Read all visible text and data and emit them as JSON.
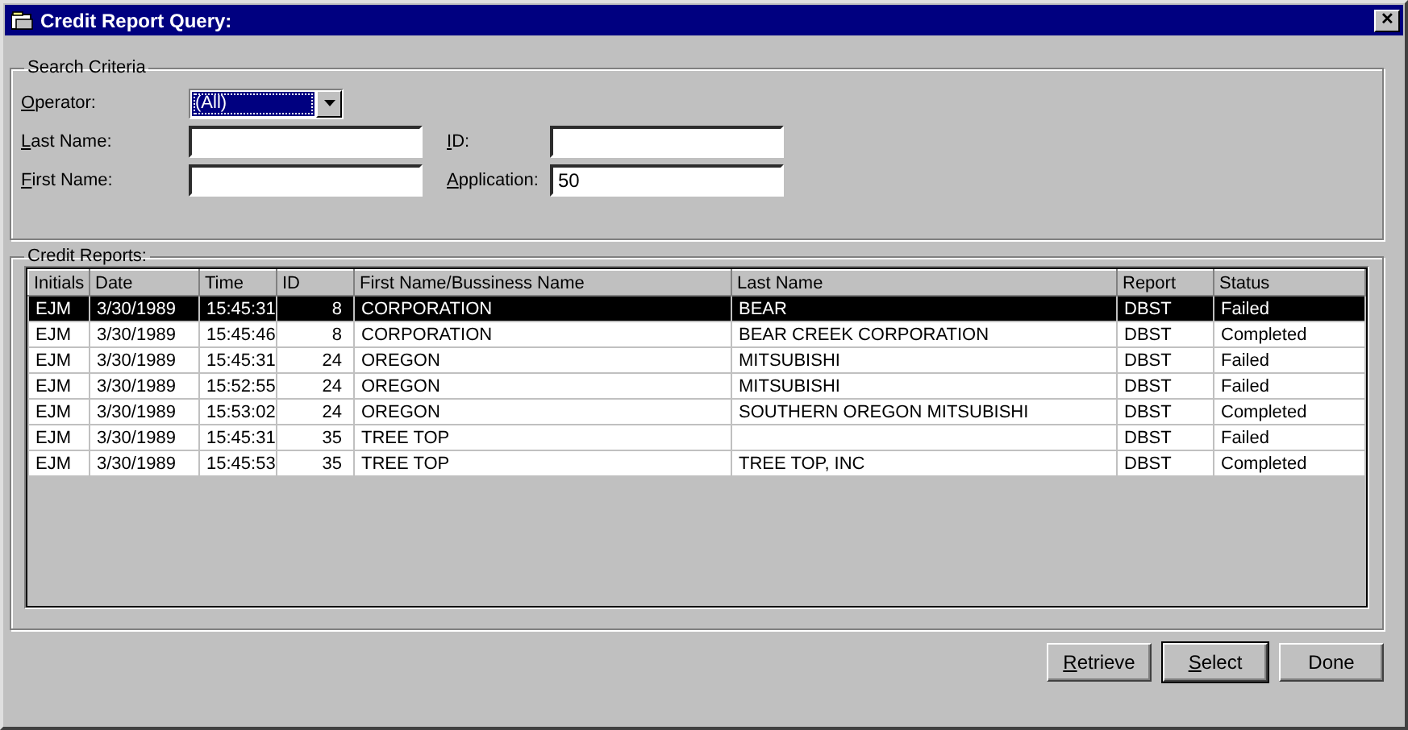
{
  "window": {
    "title": "Credit Report Query:",
    "close": "✕"
  },
  "search_criteria": {
    "title": "Search Criteria",
    "operator": {
      "label": "Operator:",
      "underline_first": true,
      "value": "(All)",
      "focused": true
    },
    "last_name": {
      "label": "Last Name:",
      "underline_first": true
    },
    "first_name": {
      "label": "First Name:",
      "underline_first": true
    },
    "id": {
      "label": "ID:",
      "underline_first": true
    },
    "application": {
      "label": "Application:",
      "underline_first": true,
      "value": "50"
    }
  },
  "credit_reports": {
    "title": "Credit Reports:",
    "columns": [
      {
        "label": "Initials"
      },
      {
        "label": "Date"
      },
      {
        "label": "Time"
      },
      {
        "label": "ID"
      },
      {
        "label": "First Name/Bussiness Name"
      },
      {
        "label": "Last Name"
      },
      {
        "label": "Report"
      },
      {
        "label": "Status"
      }
    ],
    "rows": [
      {
        "selected": true,
        "cells": [
          "EJM",
          "3/30/1989",
          "15:45:31",
          "8",
          "CORPORATION",
          "BEAR",
          "DBST",
          "Failed"
        ]
      },
      {
        "selected": false,
        "cells": [
          "EJM",
          "3/30/1989",
          "15:45:46",
          "8",
          "CORPORATION",
          "BEAR CREEK CORPORATION",
          "DBST",
          "Completed"
        ]
      },
      {
        "selected": false,
        "cells": [
          "EJM",
          "3/30/1989",
          "15:45:31",
          "24",
          "OREGON",
          "MITSUBISHI",
          "DBST",
          "Failed"
        ]
      },
      {
        "selected": false,
        "cells": [
          "EJM",
          "3/30/1989",
          "15:52:55",
          "24",
          "OREGON",
          "MITSUBISHI",
          "DBST",
          "Failed"
        ]
      },
      {
        "selected": false,
        "cells": [
          "EJM",
          "3/30/1989",
          "15:53:02",
          "24",
          "OREGON",
          "SOUTHERN OREGON MITSUBISHI",
          "DBST",
          "Completed"
        ]
      },
      {
        "selected": false,
        "cells": [
          "EJM",
          "3/30/1989",
          "15:45:31",
          "35",
          "TREE TOP",
          "",
          "DBST",
          "Failed"
        ]
      },
      {
        "selected": false,
        "cells": [
          "EJM",
          "3/30/1989",
          "15:45:53",
          "35",
          "TREE TOP",
          "TREE TOP, INC",
          "DBST",
          "Completed"
        ]
      }
    ]
  },
  "buttons": [
    {
      "label": "Retrieve",
      "underline_first": true,
      "default": false
    },
    {
      "label": "Select",
      "underline_first": true,
      "default": true
    },
    {
      "label": "Done",
      "underline_first": false,
      "default": false
    }
  ]
}
